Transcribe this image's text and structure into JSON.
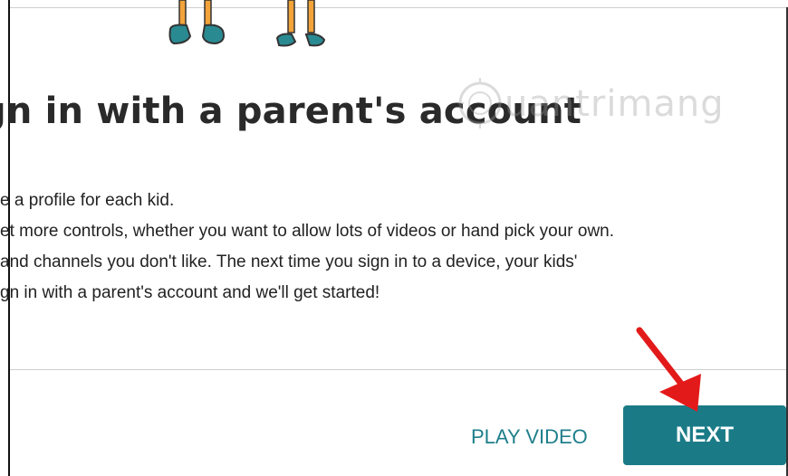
{
  "dialog": {
    "title": "gn in with a parent's account",
    "body_lines": [
      "e a profile for each kid.",
      "et more controls, whether you want to allow lots of videos or hand pick your own.",
      " and channels you don't like. The next time you sign in to a device, your kids'",
      "gn in with a parent's account and we'll get started!"
    ]
  },
  "actions": {
    "play_video_label": "PLAY VIDEO",
    "next_label": "NEXT"
  },
  "watermark": {
    "text": "uantrimang"
  },
  "colors": {
    "accent": "#1a7b87",
    "link": "#1f7f8c",
    "annotation": "#e31a1a",
    "illustration_teal": "#2a8a92",
    "illustration_orange": "#f2a33a"
  }
}
